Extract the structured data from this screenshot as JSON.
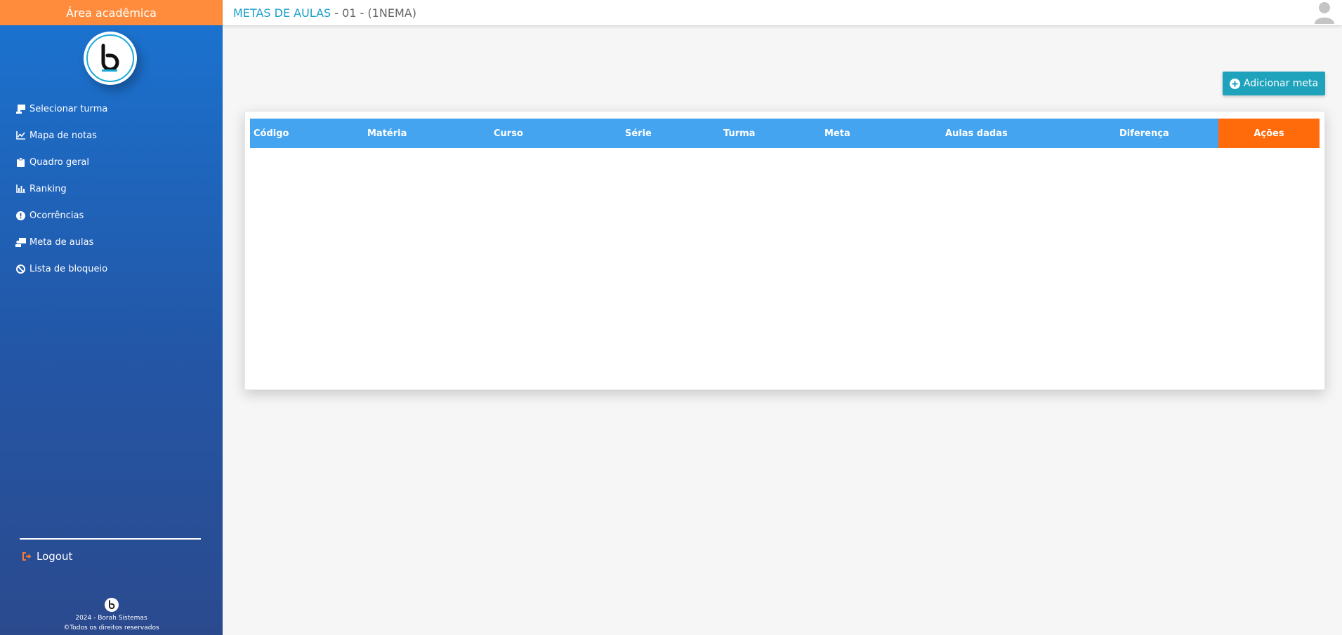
{
  "sidebar": {
    "header": "Área acadêmica",
    "logo_icon": "borah-logo",
    "items": [
      {
        "label": "Selecionar turma",
        "icon": "chalkboard-teacher-icon"
      },
      {
        "label": "Mapa de notas",
        "icon": "line-chart-icon"
      },
      {
        "label": "Quadro geral",
        "icon": "clipboard-icon"
      },
      {
        "label": "Ranking",
        "icon": "bar-chart-icon"
      },
      {
        "label": "Ocorrências",
        "icon": "exclamation-circle-icon"
      },
      {
        "label": "Meta de aulas",
        "icon": "teacher-screen-icon"
      },
      {
        "label": "Lista de bloqueio",
        "icon": "ban-icon"
      }
    ],
    "logout_label": "Logout",
    "footer": {
      "line1": "2024 - Borah Sistemas",
      "line2": "©Todos os direitos reservados"
    }
  },
  "topbar": {
    "title_accent": "METAS DE AULAS",
    "title_rest": " - 01 - (1NEMA)",
    "avatar_icon": "user-avatar-icon"
  },
  "main": {
    "add_button_label": "Adicionar meta",
    "table": {
      "columns": [
        "Código",
        "Matéria",
        "Curso",
        "Série",
        "Turma",
        "Meta",
        "Aulas dadas",
        "Diferença"
      ],
      "actions_label": "Ações",
      "rows": []
    }
  },
  "colors": {
    "header_orange": "#ff8c3c",
    "sidebar_blue": "#1a74d2",
    "title_accent": "#1aa0c8",
    "table_head": "#44a4ef",
    "actions_orange": "#ff6a0a",
    "button_teal": "#1fa3bd"
  }
}
